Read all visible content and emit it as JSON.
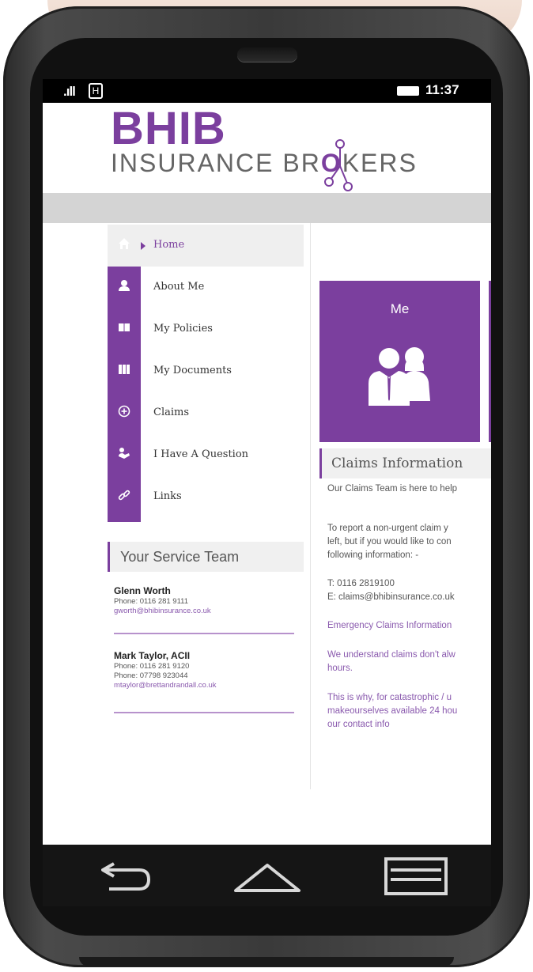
{
  "status_bar": {
    "signal": ".ıll",
    "network": "H",
    "time": "11:37"
  },
  "logo": {
    "brand": "BHIB",
    "subtitle_part1": "INSURANCE BR",
    "subtitle_o": "O",
    "subtitle_part2": "KERS"
  },
  "nav": {
    "items": [
      {
        "label": "Home",
        "icon": "home-icon",
        "active": true
      },
      {
        "label": "About Me",
        "icon": "person-icon"
      },
      {
        "label": "My Policies",
        "icon": "book-icon"
      },
      {
        "label": "My Documents",
        "icon": "documents-icon"
      },
      {
        "label": "Claims",
        "icon": "plus-circle-icon"
      },
      {
        "label": "I Have A Question",
        "icon": "question-icon"
      },
      {
        "label": "Links",
        "icon": "link-icon"
      }
    ]
  },
  "service_team": {
    "heading": "Your Service Team",
    "contacts": [
      {
        "name": "Glenn Worth",
        "phone1": "Phone: 0116 281 9111",
        "email": "gworth@bhibinsurance.co.uk"
      },
      {
        "name": "Mark Taylor, ACII",
        "phone1": "Phone: 0116 281 9120",
        "phone2": "Phone: 07798 923044",
        "email": "mtaylor@brettandrandall.co.uk"
      }
    ]
  },
  "tile": {
    "title": "Me",
    "icon": "people-icon"
  },
  "claims": {
    "heading": "Claims Information",
    "lines": [
      "Our Claims Team is here to help",
      "To report a non-urgent claim y",
      "left, but if you would like to con",
      "following information: -",
      "T: 0116 2819100",
      "E: claims@bhibinsurance.co.uk",
      "Emergency Claims Information",
      "We understand claims don't alw",
      "hours.",
      "This is why, for catastrophic / u",
      "makeourselves available 24 hou",
      "our contact info"
    ]
  },
  "colors": {
    "brand_purple": "#7b3f9e",
    "grey_bar": "#d4d4d4"
  }
}
